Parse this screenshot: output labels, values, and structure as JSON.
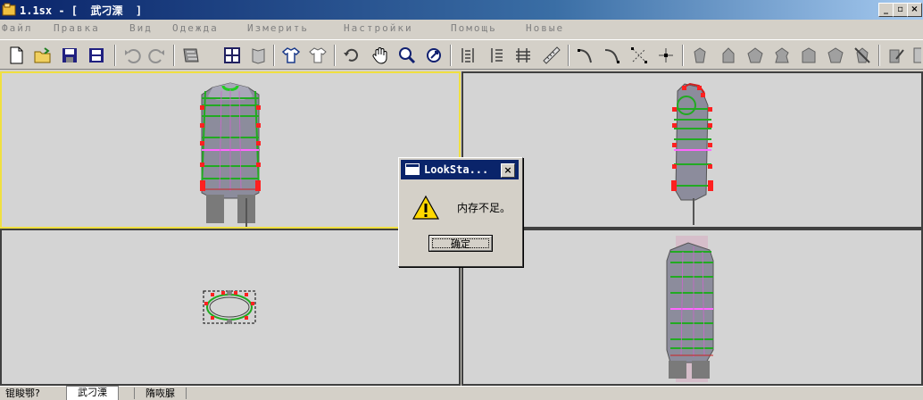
{
  "window": {
    "title": "1.1sx - [  武刁溧  ]",
    "controls": [
      "_",
      "▫",
      "×"
    ]
  },
  "menu": {
    "items": [
      "Файл",
      "Правка",
      "Вид",
      "Одежда",
      "Измерить",
      "Настройки",
      "Помощь",
      "Новые"
    ]
  },
  "toolbar": {
    "icons": [
      "new-file-icon",
      "open-folder-icon",
      "save-icon",
      "save-all-icon",
      "undo-icon",
      "redo-icon",
      "fabric-icon",
      "panel-icon",
      "flag-icon",
      "shirt-icon",
      "pattern-icon",
      "rotate-icon",
      "hand-pan-icon",
      "zoom-icon",
      "fit-view-icon",
      "measure-bars-icon",
      "measure-list-icon",
      "measure-grid-icon",
      "ruler-icon",
      "curve-icon",
      "curve-2-icon",
      "points-icon",
      "align-icon",
      "mannequin-1-icon",
      "mannequin-2-icon",
      "mannequin-3-icon",
      "mannequin-4-icon",
      "mannequin-5-icon",
      "mannequin-6-icon",
      "mannequin-7-icon",
      "mannequin-8-icon",
      "edit-icon",
      "book-icon"
    ]
  },
  "dialog": {
    "title": "LookSta...",
    "message": "内存不足。",
    "ok_label": "确定",
    "close_label": "×"
  },
  "status": {
    "tabs": [
      "锟睃鄂?",
      "武刁溧",
      "隋咴脲"
    ],
    "selected_index": 1
  },
  "colors": {
    "title_start": "#0a246a",
    "title_end": "#a6caf0",
    "viewport_bg": "#d4d4d4",
    "active_border": "#f0e040",
    "measure_green": "#22aa22",
    "measure_pink": "#ff66ff",
    "point_red": "#ff2020"
  }
}
